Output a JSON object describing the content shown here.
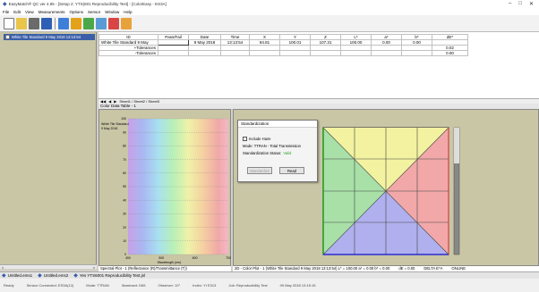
{
  "window": {
    "title": "EasyMatch® QC ver 4.95 - [Setup 2: YTS(601 Reproducibility Test] - [ColorEasy - ES3A]",
    "controls": [
      "–",
      "□",
      "✕"
    ]
  },
  "menu": [
    "File",
    "Edit",
    "View",
    "Measurements",
    "Options",
    "Sensor",
    "Window",
    "Help"
  ],
  "toolbar": {
    "icons": [
      "new-file-icon",
      "open-folder-icon",
      "print-icon",
      "save-icon",
      "chart-icon",
      "standard-icon",
      "sample-icon",
      "color-icon",
      "read-icon",
      "tolerance-icon"
    ]
  },
  "sidebar": {
    "item": "White Tile Standard 9 May 2018 13:13:54",
    "bottom_left": "<",
    "bottom_right": ">"
  },
  "table": {
    "headers": [
      "ID",
      "Pass/Fail",
      "Date",
      "Time",
      "X",
      "Y",
      "Z",
      "L*",
      "a*",
      "b*",
      "dE*"
    ],
    "rows": [
      [
        "White Tile Standard 9 May",
        "",
        "9 May 2018",
        "13:13:54",
        "94.81",
        "100.01",
        "107.31",
        "100.00",
        "0.00",
        "0.00",
        ""
      ],
      [
        "+Tolerances",
        "",
        "",
        "",
        "",
        "",
        "",
        "",
        "",
        "",
        "0.02"
      ],
      [
        "-Tolerances",
        "",
        "",
        "",
        "",
        "",
        "",
        "",
        "",
        "",
        "0.00"
      ]
    ],
    "scroll_label": "Sheet1 / Sheet2 / Sheet3",
    "panel_label": "Color Data Table - 1"
  },
  "spectral": {
    "legend": [
      "White Tile Standard",
      "9 May 2018"
    ],
    "yticks": [
      "100",
      "90",
      "80",
      "70",
      "60",
      "50",
      "40",
      "30",
      "20",
      "10",
      "0"
    ],
    "xticks": [
      "400",
      "500",
      "600",
      "700"
    ],
    "xlabel": "Wavelength (nm)",
    "status": "Spectral Plot - 1 (Reflectance (R)/Transmittance (T))"
  },
  "colorplot": {
    "status": "2D - Color Plot - 1 (White Tile Standard 9 May 2018 13:13:54) L* = 100.00  a* = 0.00  b* = 0.00",
    "status_extra": [
      "dE = 0.00",
      "DELTA E*A",
      "ONLINE"
    ]
  },
  "dialog": {
    "title": "Standardization",
    "checkbox_label": "Include Haze",
    "mode_label": "Mode: TTRAN - Total Transmission",
    "status_label": "Standardization Status:",
    "status_value": "Valid",
    "standardize_button": "Standardize",
    "read_button": "Read"
  },
  "tabs": [
    {
      "label": "Untitled.ems1"
    },
    {
      "label": "Untitled.ems2"
    },
    {
      "label": "Yes YTS6001 Reproducibility Test.jnl"
    }
  ],
  "bottombar": [
    "Ready",
    "Sensor Connected: ES3A(12)",
    "Mode: TTRAN",
    "Illuminant: D65",
    "Observer: 10°",
    "Index: YI E313",
    "Job: Reproducibility Test",
    "09 May 2018 13:15:15"
  ]
}
